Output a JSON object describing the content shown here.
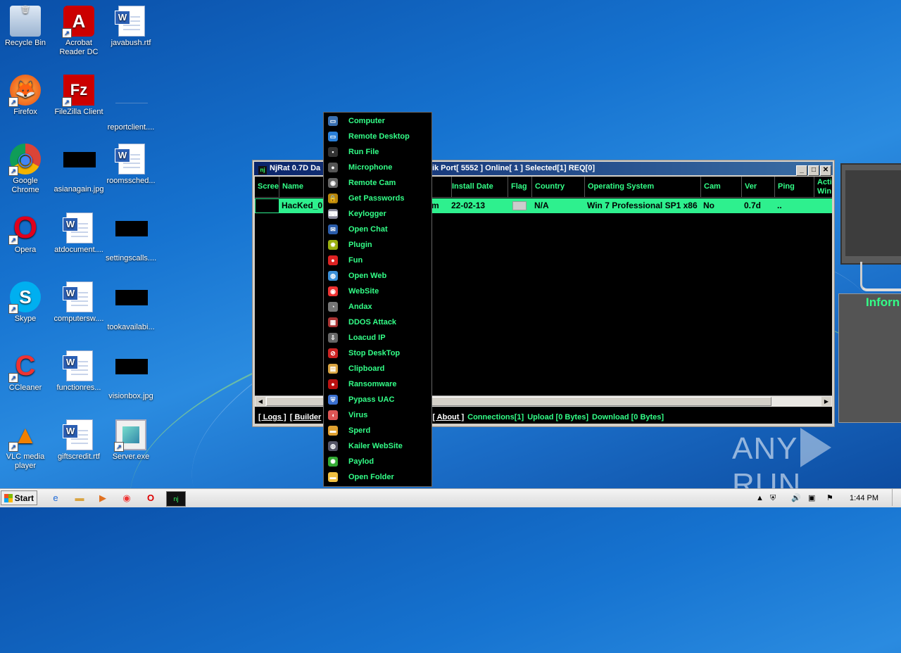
{
  "desktop": {
    "icons": [
      {
        "label": "Recycle Bin",
        "glyph": "🗑",
        "kind": "app"
      },
      {
        "label": "Acrobat Reader DC",
        "glyph": "A",
        "kind": "acrobat"
      },
      {
        "label": "javabush.rtf",
        "kind": "doc"
      },
      {
        "label": "Firefox",
        "glyph": "🦊",
        "kind": "firefox"
      },
      {
        "label": "FileZilla Client",
        "glyph": "Fz",
        "kind": "filezilla"
      },
      {
        "label": "reportclient....",
        "kind": "blank"
      },
      {
        "label": "Google Chrome",
        "glyph": "◉",
        "kind": "chrome"
      },
      {
        "label": "asianagain.jpg",
        "kind": "black"
      },
      {
        "label": "roomssched...",
        "kind": "doc"
      },
      {
        "label": "Opera",
        "glyph": "O",
        "kind": "opera"
      },
      {
        "label": "atdocument....",
        "kind": "doc"
      },
      {
        "label": "settingscalls....",
        "kind": "black"
      },
      {
        "label": "Skype",
        "glyph": "S",
        "kind": "skype"
      },
      {
        "label": "computersw....",
        "kind": "doc"
      },
      {
        "label": "tookavailabi...",
        "kind": "black"
      },
      {
        "label": "CCleaner",
        "glyph": "C",
        "kind": "ccleaner"
      },
      {
        "label": "functionres...",
        "kind": "doc"
      },
      {
        "label": "visionbox.jpg",
        "kind": "black"
      },
      {
        "label": "VLC media player",
        "glyph": "▲",
        "kind": "vlc"
      },
      {
        "label": "giftscredit.rtf",
        "kind": "doc"
      },
      {
        "label": "Server.exe",
        "kind": "exe"
      }
    ]
  },
  "window": {
    "title": "NjRat 0.7D Da",
    "title_suffix": "trik   Port[ 5552 ]    Online[ 1 ]    Selected[1] REQ[0]",
    "columns": [
      "Scree",
      "Name",
      "Install Date",
      "Flag",
      "Country",
      "Operating System",
      "Cam",
      "Ver",
      "Ping",
      "Acti Win"
    ],
    "row": {
      "name": "HacKed_0",
      "partial": "m",
      "install_date": "22-02-13",
      "country": "N/A",
      "os": "Win 7 Professional SP1 x86",
      "cam": "No",
      "ver": "0.7d",
      "ping": ".."
    },
    "status": {
      "logs": "[ Logs ]",
      "builder": "[ Builder",
      "about": "[ About ]",
      "connections": "Connections[1]",
      "upload": "Upload [0 Bytes]",
      "download": "Download [0 Bytes]"
    }
  },
  "context_menu": [
    {
      "label": "Computer",
      "icon": "monitor-icon",
      "color": "#3a6fb0",
      "glyph": "▭"
    },
    {
      "label": "Remote Desktop",
      "icon": "remote-desktop-icon",
      "color": "#2a7fd8",
      "glyph": "▭"
    },
    {
      "label": "Run File",
      "icon": "run-file-icon",
      "color": "#333",
      "glyph": "▪"
    },
    {
      "label": "Microphone",
      "icon": "microphone-icon",
      "color": "#555",
      "glyph": "●"
    },
    {
      "label": "Remote Cam",
      "icon": "webcam-icon",
      "color": "#666",
      "glyph": "◉"
    },
    {
      "label": "Get Passwords",
      "icon": "lock-icon",
      "color": "#b8860b",
      "glyph": "🔒"
    },
    {
      "label": "Keylogger",
      "icon": "keyboard-icon",
      "color": "#889",
      "glyph": "⌨"
    },
    {
      "label": "Open Chat",
      "icon": "chat-icon",
      "color": "#2a5caa",
      "glyph": "✉"
    },
    {
      "label": "Plugin",
      "icon": "gear-icon",
      "color": "#9ab010",
      "glyph": "✹"
    },
    {
      "label": "Fun",
      "icon": "fun-icon",
      "color": "#d22",
      "glyph": "●"
    },
    {
      "label": "Open Web",
      "icon": "globe-icon",
      "color": "#3a8fd8",
      "glyph": "◍"
    },
    {
      "label": "WebSite",
      "icon": "chrome-icon",
      "color": "#e33",
      "glyph": "◉"
    },
    {
      "label": "Andax",
      "icon": "andax-icon",
      "color": "#777",
      "glyph": "◔"
    },
    {
      "label": "DDOS Attack",
      "icon": "brick-wall-icon",
      "color": "#a33",
      "glyph": "▦"
    },
    {
      "label": "Loacud IP",
      "icon": "ip-icon",
      "color": "#666",
      "glyph": "⇩"
    },
    {
      "label": "Stop DeskTop",
      "icon": "stop-icon",
      "color": "#c22",
      "glyph": "⊘"
    },
    {
      "label": "Clipboard",
      "icon": "clipboard-icon",
      "color": "#d9a441",
      "glyph": "▤"
    },
    {
      "label": "Ransomware",
      "icon": "ransomware-icon",
      "color": "#b11",
      "glyph": "●"
    },
    {
      "label": "Pypass UAC",
      "icon": "shield-icon",
      "color": "#3a6fd0",
      "glyph": "⛨"
    },
    {
      "label": "Virus",
      "icon": "pill-icon",
      "color": "#d55",
      "glyph": "◖"
    },
    {
      "label": "Sperd",
      "icon": "folder-icon",
      "color": "#e0a030",
      "glyph": "▬"
    },
    {
      "label": "Kailer WebSite",
      "icon": "globe-icon",
      "color": "#556",
      "glyph": "◍"
    },
    {
      "label": "Paylod",
      "icon": "virus-icon",
      "color": "#3a3",
      "glyph": "✺"
    },
    {
      "label": "Open Folder",
      "icon": "open-folder-icon",
      "color": "#f0c040",
      "glyph": "▬"
    }
  ],
  "right_panel": {
    "info_text": "Inforn"
  },
  "watermark": {
    "left": "ANY",
    "right": "RUN"
  },
  "taskbar": {
    "start": "Start",
    "time": "1:44 PM"
  }
}
